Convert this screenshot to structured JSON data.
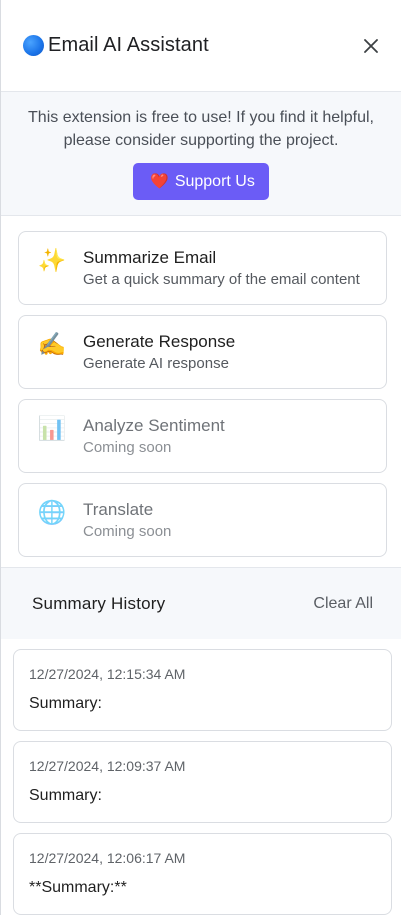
{
  "header": {
    "title": "Email AI Assistant",
    "close_icon": "close-icon",
    "logo_color": "#1a73e8"
  },
  "support": {
    "message": "This extension is free to use! If you find it helpful, please consider supporting the project.",
    "button_label": "Support Us",
    "button_icon": "❤️",
    "button_color": "#6b5cf6"
  },
  "actions": [
    {
      "title": "Summarize Email",
      "description": "Get a quick summary of the email content",
      "icon": "✨",
      "icon_name": "sparkles-icon",
      "enabled": true
    },
    {
      "title": "Generate Response",
      "description": "Generate AI response",
      "icon": "✍️",
      "icon_name": "writing-hand-icon",
      "enabled": true
    },
    {
      "title": "Analyze Sentiment",
      "description": "Coming soon",
      "icon": "📊",
      "icon_name": "bar-chart-icon",
      "enabled": false
    },
    {
      "title": "Translate",
      "description": "Coming soon",
      "icon": "🌐",
      "icon_name": "globe-icon",
      "enabled": false
    }
  ],
  "history": {
    "title": "Summary History",
    "clear_label": "Clear All",
    "items": [
      {
        "timestamp": "12/27/2024, 12:15:34 AM",
        "summary": "Summary:"
      },
      {
        "timestamp": "12/27/2024, 12:09:37 AM",
        "summary": "Summary:"
      },
      {
        "timestamp": "12/27/2024, 12:06:17 AM",
        "summary": "**Summary:**"
      }
    ]
  }
}
